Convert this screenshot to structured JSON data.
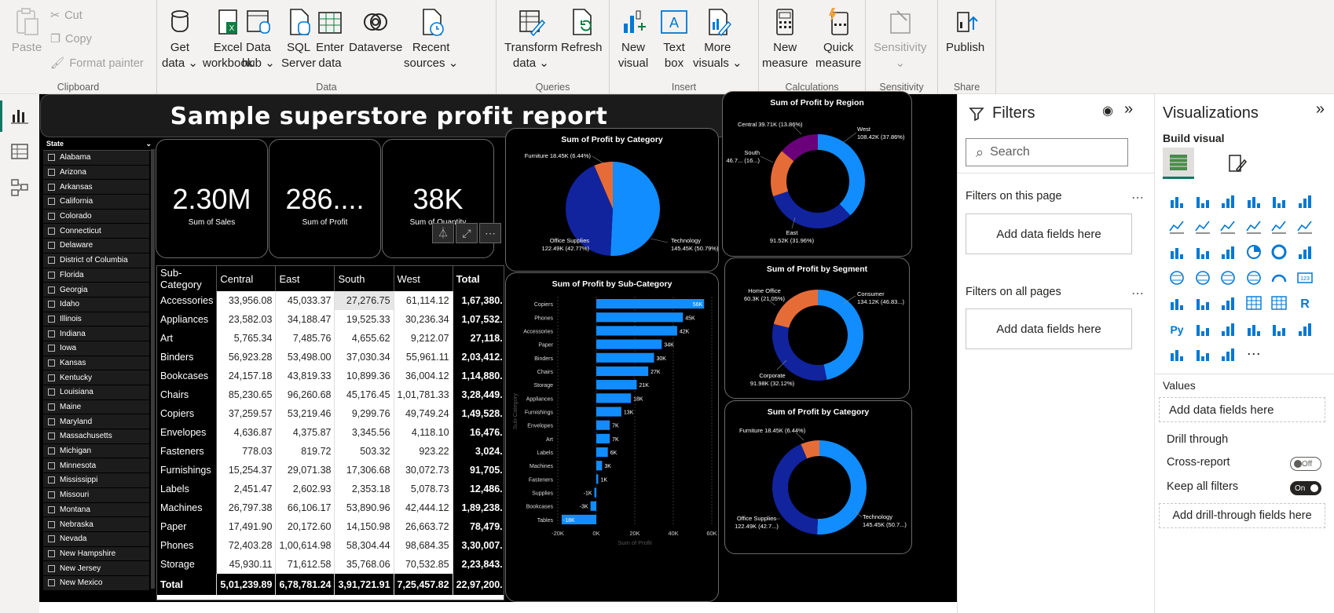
{
  "ribbon": {
    "clipboard": {
      "paste": "Paste",
      "cut": "Cut",
      "copy": "Copy",
      "format_painter": "Format painter",
      "label": "Clipboard"
    },
    "data": {
      "label": "Data",
      "buttons": [
        {
          "l1": "Get",
          "l2": "data ⌄",
          "icon": "database-icon"
        },
        {
          "l1": "Excel",
          "l2": "workbook",
          "icon": "excel-icon"
        },
        {
          "l1": "Data",
          "l2": "hub ⌄",
          "icon": "data-hub-icon"
        },
        {
          "l1": "SQL",
          "l2": "Server",
          "icon": "sql-server-icon"
        },
        {
          "l1": "Enter",
          "l2": "data",
          "icon": "table-icon"
        },
        {
          "l1": "Dataverse",
          "l2": "",
          "icon": "dataverse-icon"
        },
        {
          "l1": "Recent",
          "l2": "sources ⌄",
          "icon": "recent-sources-icon"
        }
      ]
    },
    "queries": {
      "label": "Queries",
      "buttons": [
        {
          "l1": "Transform",
          "l2": "data ⌄"
        },
        {
          "l1": "Refresh",
          "l2": ""
        }
      ]
    },
    "insert": {
      "label": "Insert",
      "buttons": [
        {
          "l1": "New",
          "l2": "visual"
        },
        {
          "l1": "Text",
          "l2": "box"
        },
        {
          "l1": "More",
          "l2": "visuals ⌄"
        }
      ]
    },
    "calculations": {
      "label": "Calculations",
      "buttons": [
        {
          "l1": "New",
          "l2": "measure"
        },
        {
          "l1": "Quick",
          "l2": "measure"
        }
      ]
    },
    "sensitivity": {
      "label": "Sensitivity",
      "buttons": [
        {
          "l1": "Sensitivity",
          "l2": "⌄"
        }
      ]
    },
    "share": {
      "label": "Share",
      "buttons": [
        {
          "l1": "Publish",
          "l2": ""
        }
      ]
    }
  },
  "report": {
    "title": "Sample superstore profit report",
    "kpis": [
      {
        "value": "2.30M",
        "label": "Sum of Sales"
      },
      {
        "value": "286....",
        "label": "Sum of Profit"
      },
      {
        "value": "38K",
        "label": "Sum of Quantity"
      }
    ],
    "slicer": {
      "header": "State",
      "items": [
        "Alabama",
        "Arizona",
        "Arkansas",
        "California",
        "Colorado",
        "Connecticut",
        "Delaware",
        "District of Columbia",
        "Florida",
        "Georgia",
        "Idaho",
        "Illinois",
        "Indiana",
        "Iowa",
        "Kansas",
        "Kentucky",
        "Louisiana",
        "Maine",
        "Maryland",
        "Massachusetts",
        "Michigan",
        "Minnesota",
        "Mississippi",
        "Missouri",
        "Montana",
        "Nebraska",
        "Nevada",
        "New Hampshire",
        "New Jersey",
        "New Mexico"
      ]
    },
    "matrix": {
      "headers": [
        "Sub-Category",
        "Central",
        "East",
        "South",
        "West",
        "Total"
      ],
      "rows": [
        [
          "Accessories",
          "33,956.08",
          "45,033.37",
          "27,276.75",
          "61,114.12",
          "1,67,380."
        ],
        [
          "Appliances",
          "23,582.03",
          "34,188.47",
          "19,525.33",
          "30,236.34",
          "1,07,532."
        ],
        [
          "Art",
          "5,765.34",
          "7,485.76",
          "4,655.62",
          "9,212.07",
          "27,118."
        ],
        [
          "Binders",
          "56,923.28",
          "53,498.00",
          "37,030.34",
          "55,961.11",
          "2,03,412."
        ],
        [
          "Bookcases",
          "24,157.18",
          "43,819.33",
          "10,899.36",
          "36,004.12",
          "1,14,880."
        ],
        [
          "Chairs",
          "85,230.65",
          "96,260.68",
          "45,176.45",
          "1,01,781.33",
          "3,28,449."
        ],
        [
          "Copiers",
          "37,259.57",
          "53,219.46",
          "9,299.76",
          "49,749.24",
          "1,49,528."
        ],
        [
          "Envelopes",
          "4,636.87",
          "4,375.87",
          "3,345.56",
          "4,118.10",
          "16,476."
        ],
        [
          "Fasteners",
          "778.03",
          "819.72",
          "503.32",
          "923.22",
          "3,024."
        ],
        [
          "Furnishings",
          "15,254.37",
          "29,071.38",
          "17,306.68",
          "30,072.73",
          "91,705."
        ],
        [
          "Labels",
          "2,451.47",
          "2,602.93",
          "2,353.18",
          "5,078.73",
          "12,486."
        ],
        [
          "Machines",
          "26,797.38",
          "66,106.17",
          "53,890.96",
          "42,444.12",
          "1,89,238."
        ],
        [
          "Paper",
          "17,491.90",
          "20,172.60",
          "14,150.98",
          "26,663.72",
          "78,479."
        ],
        [
          "Phones",
          "72,403.28",
          "1,00,614.98",
          "58,304.44",
          "98,684.35",
          "3,30,007."
        ],
        [
          "Storage",
          "45,930.11",
          "71,612.58",
          "35,768.06",
          "70,532.85",
          "2,23,843."
        ]
      ],
      "total": [
        "Total",
        "5,01,239.89",
        "6,78,781.24",
        "3,91,721.91",
        "7,25,457.82",
        "22,97,200."
      ]
    }
  },
  "chart_data": [
    {
      "type": "pie",
      "title": "Sum of Profit by Category",
      "slices": [
        {
          "name": "Technology",
          "value": 145.45,
          "label": "Technology 145.45K (50.79%)",
          "color": "#118DFF"
        },
        {
          "name": "Office Supplies",
          "value": 122.49,
          "label": "Office Supplies 122.49K (42.77%)",
          "color": "#12239E"
        },
        {
          "name": "Furniture",
          "value": 18.45,
          "label": "Furniture 18.45K (6.44%)",
          "color": "#E66C37"
        }
      ]
    },
    {
      "type": "bar",
      "title": "Sum of Profit by Sub-Category",
      "xlabel": "Sum of Profit",
      "ylabel": "Sub-Category",
      "xlim": [
        -20,
        60
      ],
      "xticks": [
        "-20K",
        "0K",
        "20K",
        "40K",
        "60K"
      ],
      "categories": [
        "Copiers",
        "Phones",
        "Accessories",
        "Paper",
        "Binders",
        "Chairs",
        "Storage",
        "Appliances",
        "Furnishings",
        "Envelopes",
        "Art",
        "Labels",
        "Machines",
        "Fasteners",
        "Supplies",
        "Bookcases",
        "Tables"
      ],
      "values": [
        56,
        45,
        42,
        34,
        30,
        27,
        21,
        18,
        13,
        7,
        7,
        6,
        3,
        1,
        -1,
        -3,
        -18
      ],
      "data_labels": [
        "56K",
        "45K",
        "42K",
        "34K",
        "30K",
        "27K",
        "21K",
        "18K",
        "13K",
        "7K",
        "7K",
        "6K",
        "3K",
        "1K",
        "-1K",
        "-3K",
        "-18K"
      ],
      "color": "#118DFF"
    },
    {
      "type": "pie",
      "subtype": "donut",
      "title": "Sum of Profit by Region",
      "slices": [
        {
          "name": "West",
          "value": 108.42,
          "label": "West 108.42K (37.86%)",
          "color": "#118DFF"
        },
        {
          "name": "East",
          "value": 91.52,
          "label": "East 91.52K (31.96%)",
          "color": "#12239E"
        },
        {
          "name": "South",
          "value": 46.7,
          "label": "South 46.7... (16...)",
          "color": "#E66C37"
        },
        {
          "name": "Central",
          "value": 39.71,
          "label": "Central 39.71K (13.86%)",
          "color": "#6B007B"
        }
      ]
    },
    {
      "type": "pie",
      "subtype": "donut",
      "title": "Sum of Profit by Segment",
      "slices": [
        {
          "name": "Consumer",
          "value": 134.12,
          "label": "Consumer 134.12K (46.83...)",
          "color": "#118DFF"
        },
        {
          "name": "Corporate",
          "value": 91.98,
          "label": "Corporate 91.98K (32.12%)",
          "color": "#12239E"
        },
        {
          "name": "Home Office",
          "value": 60.3,
          "label": "Home Office 60.3K (21.05%)",
          "color": "#E66C37"
        }
      ]
    },
    {
      "type": "pie",
      "subtype": "donut",
      "title": "Sum of Profit by Category",
      "slices": [
        {
          "name": "Technology",
          "value": 145.45,
          "label": "Technology 145.45K (50.7...)",
          "color": "#118DFF"
        },
        {
          "name": "Office Supplies",
          "value": 122.49,
          "label": "Office Supplies 122.49K (42.7...)",
          "color": "#12239E"
        },
        {
          "name": "Furniture",
          "value": 18.45,
          "label": "Furniture 18.45K (6.44%)",
          "color": "#E66C37"
        }
      ]
    }
  ],
  "filters": {
    "title": "Filters",
    "search_placeholder": "Search",
    "on_page": "Filters on this page",
    "on_all": "Filters on all pages",
    "add": "Add data fields here"
  },
  "visualizations": {
    "title": "Visualizations",
    "build": "Build visual",
    "values": "Values",
    "add_values": "Add data fields here",
    "drill": "Drill through",
    "cross": "Cross-report",
    "cross_state": "Off",
    "keep": "Keep all filters",
    "keep_state": "On",
    "add_drill": "Add drill-through fields here"
  }
}
